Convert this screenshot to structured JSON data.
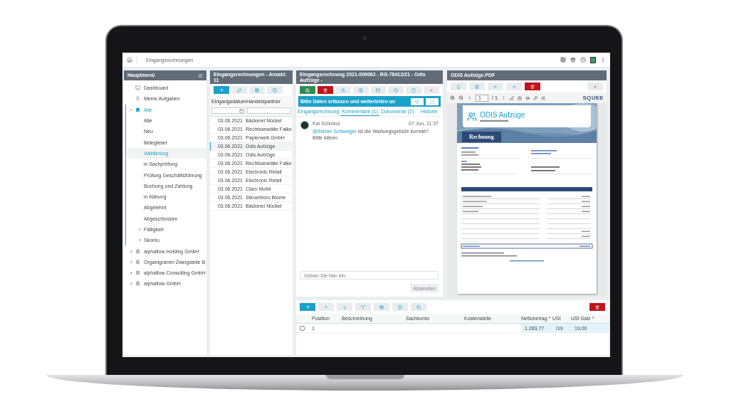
{
  "topbar": {
    "breadcrumb": "Eingangsrechnungen"
  },
  "sidebar": {
    "title": "Hauptmenü",
    "items": [
      {
        "label": "Dashboard",
        "kind": "dashboard",
        "selected": false
      },
      {
        "label": "Meine Aufgaben",
        "kind": "tasks",
        "selected": false
      },
      {
        "label": "Alle",
        "kind": "folder",
        "selected": false,
        "active": true,
        "expanded": true,
        "children": [
          {
            "label": "Alle",
            "selected": false
          },
          {
            "label": "Neu",
            "selected": false
          },
          {
            "label": "Belegleser",
            "selected": false
          },
          {
            "label": "Validierung",
            "selected": true
          },
          {
            "label": "in Sachprüfung",
            "selected": false
          },
          {
            "label": "Prüfung Geschäftsführung",
            "selected": false
          },
          {
            "label": "Buchung und Zahlung",
            "selected": false
          },
          {
            "label": "in Klärung",
            "selected": false
          },
          {
            "label": "Abgelehnt",
            "selected": false
          },
          {
            "label": "Abgeschlossen",
            "selected": false
          },
          {
            "label": "Fälligkeit",
            "selected": false,
            "expanded": false
          },
          {
            "label": "Skonto",
            "selected": false,
            "expanded": false
          }
        ]
      },
      {
        "label": "alphaflow Holding GmbH",
        "kind": "folder",
        "selected": false,
        "active": false,
        "expanded": false
      },
      {
        "label": "Organigramm Zweigstelle B",
        "kind": "folder",
        "selected": false,
        "active": false,
        "expanded": false
      },
      {
        "label": "alphaflow Consulting GmbH",
        "kind": "folder",
        "selected": false,
        "active": false,
        "expanded": false
      },
      {
        "label": "alphaflow GmbH",
        "kind": "folder",
        "selected": false,
        "active": false,
        "expanded": false
      }
    ]
  },
  "list": {
    "title": "Eingangsrechnungen - Anzahl: 11",
    "columns": [
      "Eingangsdatum",
      "Handelspartner"
    ],
    "rows": [
      {
        "date": "03.06.2021",
        "partner": "Bäckerei Nückel",
        "selected": false
      },
      {
        "date": "03.06.2021",
        "partner": "Rechtsanwälte Falke",
        "selected": false
      },
      {
        "date": "03.06.2021",
        "partner": "Papierwelt GmbH",
        "selected": false
      },
      {
        "date": "03.06.2021",
        "partner": "Odis Aufzüge",
        "selected": true
      },
      {
        "date": "03.06.2021",
        "partner": "Odis Aufzüge",
        "selected": false
      },
      {
        "date": "03.06.2021",
        "partner": "Rechtsanwälte Falke",
        "selected": false
      },
      {
        "date": "03.06.2021",
        "partner": "Electronic Retail",
        "selected": false
      },
      {
        "date": "03.06.2021",
        "partner": "Electronic Retail",
        "selected": false
      },
      {
        "date": "03.06.2021",
        "partner": "Claro Mobil",
        "selected": false
      },
      {
        "date": "03.06.2021",
        "partner": "Steuerbüro Blome",
        "selected": false
      },
      {
        "date": "03.06.2021",
        "partner": "Bäckerei Nückel",
        "selected": false
      }
    ]
  },
  "detail": {
    "title": "Eingangsrechnung 2021-000062 - RG-78412/21 - Odis Aufzüge -",
    "task": "Bitte Daten erfassen und weiterleiten an",
    "tabs": [
      {
        "label": "Eingangsrechnung",
        "selected": false
      },
      {
        "label": "Kommentare (1)",
        "selected": true
      },
      {
        "label": "Dokumente (2)",
        "selected": false
      },
      {
        "label": "Historie",
        "selected": false
      }
    ],
    "comments": [
      {
        "author": "Kai Schickor",
        "time": "07 Jun, 11:37",
        "mention": "@Stefan Schweiger",
        "text": " ist die Wartungsgebühr korrekt? Bitte klären."
      }
    ],
    "input": {
      "placeholder": "Geben Sie hier ein.."
    },
    "send": "Absenden"
  },
  "pdf": {
    "title": "ODIS Aufzüge.PDF",
    "page": "1",
    "pages": "/ 1",
    "logo": "SQUEE",
    "document": {
      "company": "ODIS Aufzüge",
      "heading": "Rechnung"
    }
  },
  "positions": {
    "columns": [
      {
        "label": "Position"
      },
      {
        "label": "Beschreibung"
      },
      {
        "label": "Sachkonto"
      },
      {
        "label": "Kostenstelle"
      },
      {
        "label": "Nettobetrag",
        "mark": "*"
      },
      {
        "label": "USt"
      },
      {
        "label": "USt Satz",
        "mark": "*"
      }
    ],
    "rows": [
      {
        "checked": false,
        "cells": [
          "1",
          "",
          "",
          "",
          "1.283,77",
          "I19",
          "19,00"
        ]
      }
    ]
  }
}
